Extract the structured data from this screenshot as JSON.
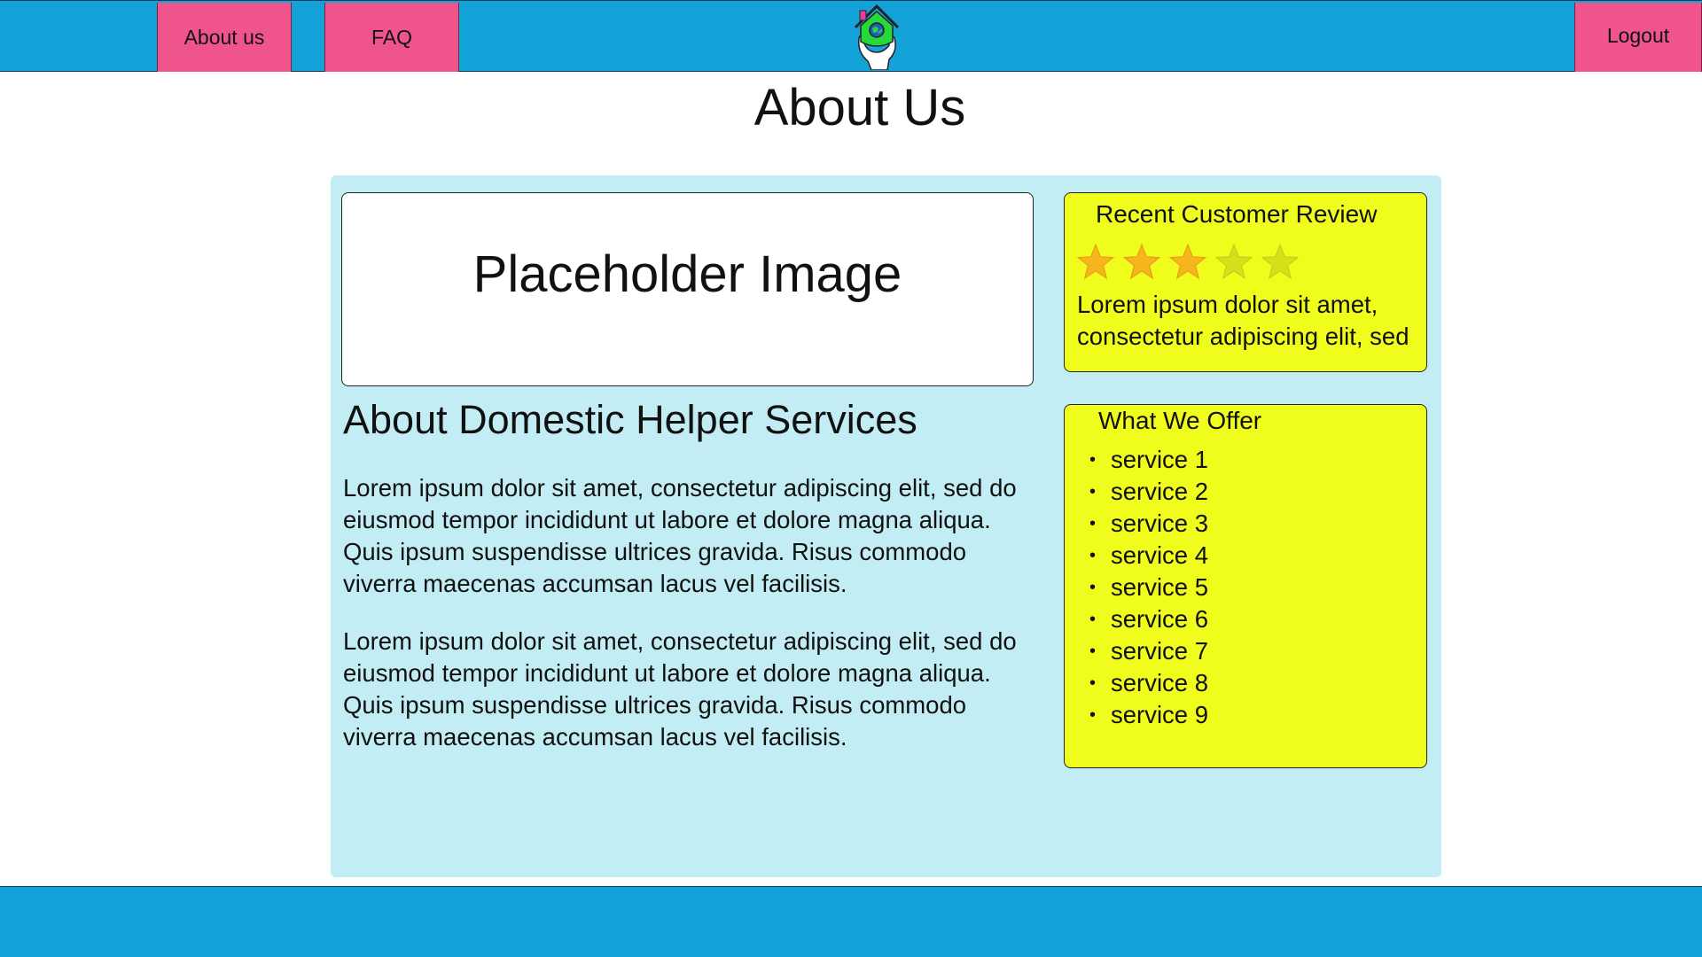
{
  "nav": {
    "about_label": "About us",
    "faq_label": "FAQ",
    "logout_label": "Logout"
  },
  "page": {
    "title": "About Us"
  },
  "main": {
    "image_placeholder": "Placeholder Image",
    "section_heading": "About Domestic Helper Services",
    "paragraphs": [
      "Lorem ipsum dolor sit amet, consectetur adipiscing elit, sed do eiusmod tempor incididunt ut labore et dolore magna aliqua. Quis ipsum suspendisse ultrices gravida. Risus commodo viverra maecenas accumsan lacus vel facilisis.",
      "Lorem ipsum dolor sit amet, consectetur adipiscing elit, sed do eiusmod tempor incididunt ut labore et dolore magna aliqua. Quis ipsum suspendisse ultrices gravida. Risus commodo viverra maecenas accumsan lacus vel facilisis."
    ]
  },
  "review": {
    "title": "Recent Customer Review",
    "rating": 3,
    "max_rating": 5,
    "text": "Lorem ipsum dolor sit amet, consectetur adipiscing elit, sed"
  },
  "offer": {
    "title": "What We Offer",
    "bullet": "•",
    "services": [
      "service 1",
      "service 2",
      "service 3",
      "service 4",
      "service 5",
      "service 6",
      "service 7",
      "service 8",
      "service 9"
    ]
  },
  "colors": {
    "nav_bar": "#14a3d9",
    "nav_button": "#f0548c",
    "panel": "#c3edf4",
    "card": "#f0fc1c",
    "star_filled": "#f7b51e",
    "star_empty": "#d4e01a"
  },
  "icons": {
    "logo": "house-in-hand-logo-icon",
    "star": "star-icon"
  }
}
